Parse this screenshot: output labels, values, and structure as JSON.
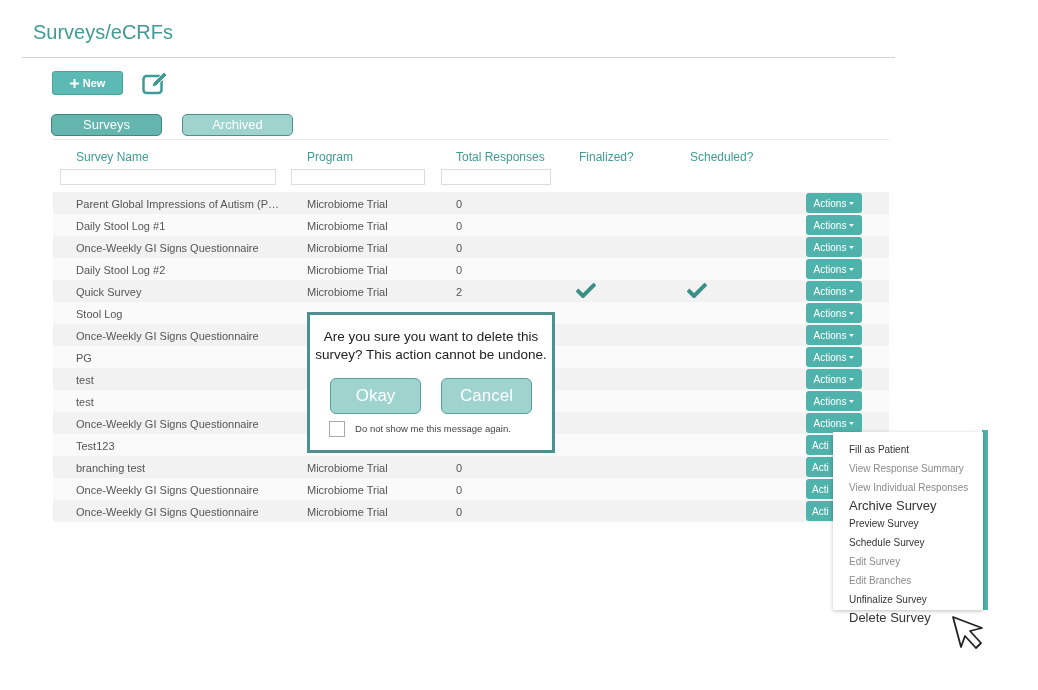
{
  "page": {
    "title": "Surveys/eCRFs"
  },
  "toolbar": {
    "new_button": "New"
  },
  "tabs": [
    {
      "label": "Surveys",
      "selected": true
    },
    {
      "label": "Archived",
      "selected": false
    }
  ],
  "table": {
    "columns": [
      "Survey Name",
      "Program",
      "Total Responses",
      "Finalized?",
      "Scheduled?"
    ],
    "rows": [
      {
        "name": "Parent Global Impressions of Autism (P…",
        "program": "Microbiome Trial",
        "responses": "0",
        "finalized": false,
        "scheduled": false,
        "action": "Actions"
      },
      {
        "name": "Daily Stool Log #1",
        "program": "Microbiome Trial",
        "responses": "0",
        "finalized": false,
        "scheduled": false,
        "action": "Actions"
      },
      {
        "name": "Once-Weekly GI Signs Questionnaire",
        "program": "Microbiome Trial",
        "responses": "0",
        "finalized": false,
        "scheduled": false,
        "action": "Actions"
      },
      {
        "name": "Daily Stool Log #2",
        "program": "Microbiome Trial",
        "responses": "0",
        "finalized": false,
        "scheduled": false,
        "action": "Actions"
      },
      {
        "name": "Quick Survey",
        "program": "Microbiome Trial",
        "responses": "2",
        "finalized": true,
        "scheduled": true,
        "action": "Actions"
      },
      {
        "name": "Stool Log",
        "finalized": false,
        "scheduled": false,
        "action": "Actions"
      },
      {
        "name": "Once-Weekly GI Signs Questionnaire",
        "finalized": false,
        "scheduled": false,
        "action": "Actions"
      },
      {
        "name": "PG",
        "finalized": false,
        "scheduled": false,
        "action": "Actions"
      },
      {
        "name": "test",
        "finalized": false,
        "scheduled": false,
        "action": "Actions"
      },
      {
        "name": "test",
        "finalized": false,
        "scheduled": false,
        "action": "Actions"
      },
      {
        "name": "Once-Weekly GI Signs Questionnaire",
        "finalized": false,
        "scheduled": false,
        "action": "Actions"
      },
      {
        "name": "Test123",
        "finalized": false,
        "scheduled": false,
        "action": "Acti"
      },
      {
        "name": "branching test",
        "program": "Microbiome Trial",
        "responses": "0",
        "finalized": false,
        "scheduled": false,
        "action": "Acti"
      },
      {
        "name": "Once-Weekly GI Signs Questionnaire",
        "program": "Microbiome Trial",
        "responses": "0",
        "finalized": false,
        "scheduled": false,
        "action": "Acti"
      },
      {
        "name": "Once-Weekly GI Signs Questionnaire",
        "program": "Microbiome Trial",
        "responses": "0",
        "finalized": false,
        "scheduled": false,
        "action": "Acti"
      }
    ]
  },
  "dialog": {
    "message": "Are you sure you want to delete this survey? This action cannot be undone.",
    "buttons": [
      "Okay",
      "Cancel"
    ],
    "checkbox": {
      "label": "Do not show me this message again.",
      "checked": false
    }
  },
  "menu": {
    "items": [
      {
        "label": "Fill as Patient",
        "kind": "item",
        "disabled": false
      },
      {
        "label": "View Response Summary",
        "kind": "item",
        "disabled": true
      },
      {
        "label": "View Individual Responses",
        "kind": "item",
        "disabled": true
      },
      {
        "label": "Archive Survey",
        "kind": "large",
        "disabled": false
      },
      {
        "label": "Preview Survey",
        "kind": "item",
        "disabled": false
      },
      {
        "label": "Schedule Survey",
        "kind": "item",
        "disabled": false
      },
      {
        "label": "Edit Survey",
        "kind": "item",
        "disabled": true
      },
      {
        "label": "Edit Branches",
        "kind": "item",
        "disabled": true
      },
      {
        "label": "Unfinalize Survey",
        "kind": "item",
        "disabled": false
      },
      {
        "label": "Delete Survey",
        "kind": "large",
        "disabled": false
      }
    ]
  }
}
